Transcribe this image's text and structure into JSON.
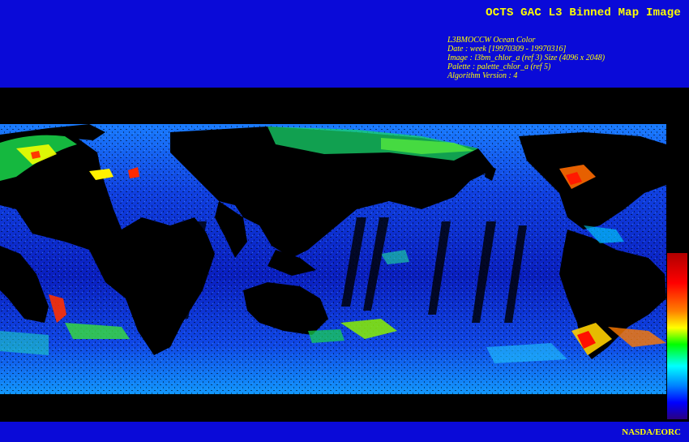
{
  "title": "OCTS GAC L3 Binned Map Image",
  "metadata": [
    "L3BMOCCW Ocean Color",
    "Date : week [19970309 - 19970316]",
    "Image : l3bm_chlor_a (ref 3) Size (4096 x 2048)",
    "Palette : palette_chlor_a (ref 5)",
    "Algorithm Version : 4"
  ],
  "credit": "NASDA/EORC",
  "colors": {
    "banner": "#0a0ad8",
    "text": "#ffff00",
    "land": "#000000"
  },
  "colorbar": {
    "palette": [
      "#ff0000",
      "#ff8000",
      "#ffff00",
      "#00ff00",
      "#00ffff",
      "#0080ff",
      "#0000ff",
      "#2000a0"
    ]
  }
}
